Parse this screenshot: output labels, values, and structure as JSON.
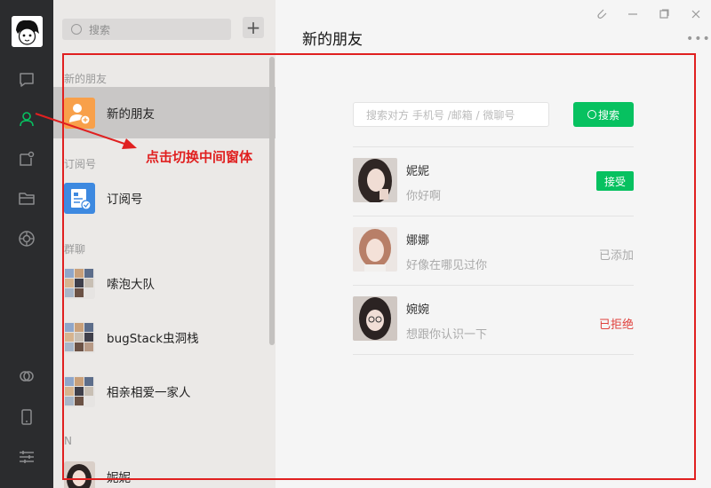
{
  "sidebar_icons": [
    "chat-icon",
    "contacts-icon",
    "collect-icon",
    "folder-icon",
    "moments-icon",
    "mini-program-icon",
    "phone-icon",
    "settings-icon"
  ],
  "list": {
    "search_placeholder": "搜索",
    "add_label": "+",
    "groups": {
      "new_friends": "新的朋友",
      "subscriptions": "订阅号",
      "group_chats": "群聊",
      "letter_n": "N"
    },
    "items": {
      "new_friends": "新的朋友",
      "subscriptions": "订阅号",
      "group1": "嗦泡大队",
      "group2": "bugStack虫洞栈",
      "group3": "相亲相爱一家人",
      "contact1": "妮妮"
    }
  },
  "main": {
    "title": "新的朋友",
    "menu_dots": "•••",
    "search_placeholder": "搜索对方 手机号 /邮箱 / 微聊号",
    "search_button": "搜索",
    "requests": [
      {
        "name": "妮妮",
        "message": "你好啊",
        "status": "接受",
        "status_type": "button"
      },
      {
        "name": "娜娜",
        "message": "好像在哪见过你",
        "status": "已添加",
        "status_type": "added"
      },
      {
        "name": "婉婉",
        "message": "想跟你认识一下",
        "status": "已拒绝",
        "status_type": "rejected"
      }
    ]
  },
  "annotation": {
    "text": "点击切换中间窗体"
  },
  "colors": {
    "accent": "#07c160",
    "annotation": "#e02020",
    "rejected": "#e0413d",
    "added": "#aaaaaa"
  }
}
